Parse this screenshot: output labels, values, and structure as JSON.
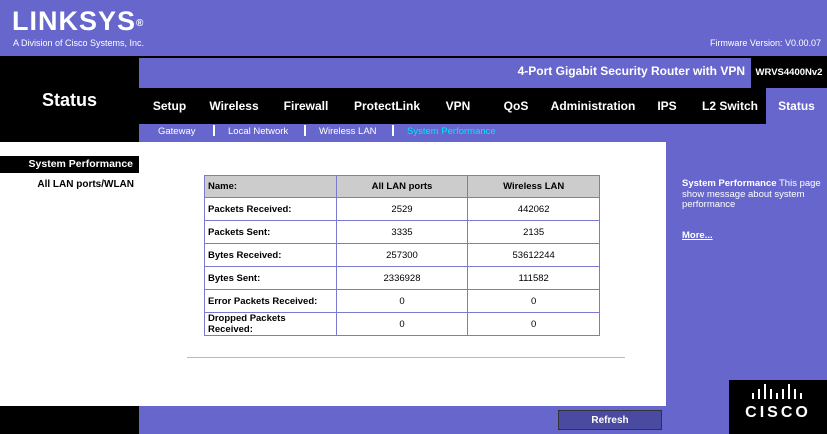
{
  "header": {
    "logo": "LINKSYS",
    "logo_mark": "®",
    "subtitle": "A Division of Cisco Systems, Inc.",
    "firmware": "Firmware Version: V0.00.07"
  },
  "product": {
    "name": "4-Port Gigabit Security Router with VPN",
    "model": "WRVS4400Nv2"
  },
  "section_title": "Status",
  "tabs": [
    {
      "label": "Setup"
    },
    {
      "label": "Wireless"
    },
    {
      "label": "Firewall"
    },
    {
      "label": "ProtectLink"
    },
    {
      "label": "VPN"
    },
    {
      "label": "QoS"
    },
    {
      "label": "Administration"
    },
    {
      "label": "IPS"
    },
    {
      "label": "L2 Switch"
    },
    {
      "label": "Status"
    }
  ],
  "subtabs": [
    {
      "label": "Gateway"
    },
    {
      "label": "Local Network"
    },
    {
      "label": "Wireless LAN"
    },
    {
      "label": "System Performance"
    }
  ],
  "sidebar": {
    "active": "System Performance",
    "item": "All LAN ports/WLAN"
  },
  "table": {
    "headers": [
      "Name:",
      "All LAN ports",
      "Wireless LAN"
    ],
    "rows": [
      [
        "Packets Received:",
        "2529",
        "442062"
      ],
      [
        "Packets Sent:",
        "3335",
        "2135"
      ],
      [
        "Bytes Received:",
        "257300",
        "53612244"
      ],
      [
        "Bytes Sent:",
        "2336928",
        "111582"
      ],
      [
        "Error Packets Received:",
        "0",
        "0"
      ],
      [
        "Dropped Packets Received:",
        "0",
        "0"
      ]
    ]
  },
  "help": {
    "title": "System Performance",
    "text": " This page show message about system performance",
    "more": "More..."
  },
  "refresh_label": "Refresh",
  "cisco_label": "CISCO",
  "colors": {
    "accent": "#6666cc",
    "active_subtab": "#00e5ff"
  }
}
